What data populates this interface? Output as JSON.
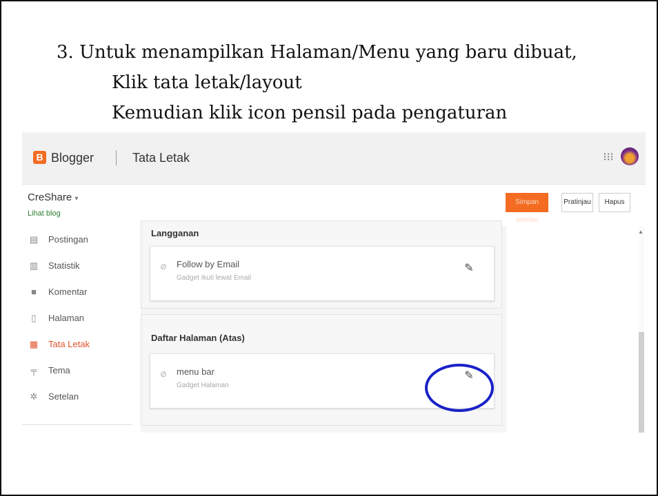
{
  "instructions": {
    "line1": "3. Untuk menampilkan Halaman/Menu yang baru dibuat,",
    "line2": "Klik tata letak/layout",
    "line3": "Kemudian klik icon pensil pada pengaturan"
  },
  "app": {
    "brand": "Blogger",
    "section": "Tata Letak",
    "logo_letter": "B"
  },
  "blog": {
    "name": "CreShare",
    "view_link": "Lihat blog"
  },
  "actions": {
    "save": "Simpan setelan",
    "preview": "Pratinjau",
    "delete": "Hapus"
  },
  "sidebar": {
    "items": [
      {
        "label": "Postingan",
        "icon": "posts-icon"
      },
      {
        "label": "Statistik",
        "icon": "stats-icon"
      },
      {
        "label": "Komentar",
        "icon": "comments-icon"
      },
      {
        "label": "Halaman",
        "icon": "pages-icon"
      },
      {
        "label": "Tata Letak",
        "icon": "layout-icon",
        "active": true
      },
      {
        "label": "Tema",
        "icon": "theme-icon"
      },
      {
        "label": "Setelan",
        "icon": "settings-icon"
      }
    ]
  },
  "panels": [
    {
      "title": "Langganan",
      "gadget": {
        "title": "Follow by Email",
        "subtitle": "Gadget Ikuti lewat Email"
      }
    },
    {
      "title": "Daftar Halaman (Atas)",
      "gadget": {
        "title": "menu bar",
        "subtitle": "Gadget Halaman"
      }
    }
  ],
  "colors": {
    "accent": "#f36c22",
    "active_nav": "#e0542b",
    "highlight_circle": "#1a22c8",
    "view_link": "#2e7d32"
  }
}
